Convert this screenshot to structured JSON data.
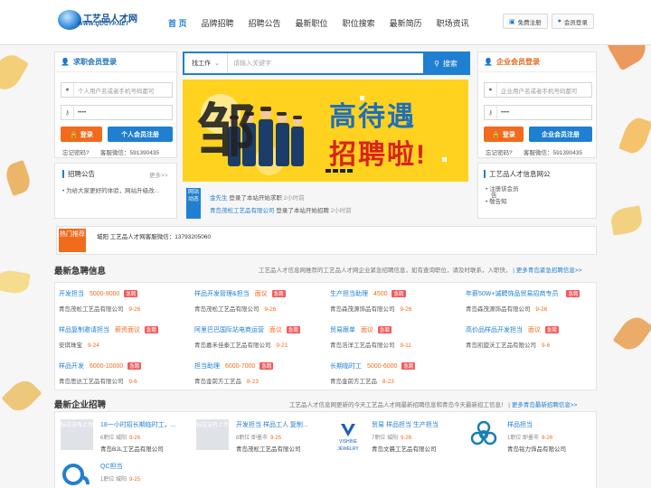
{
  "header": {
    "logo_title": "工艺品人才网",
    "logo_url": "WWW.QDGYP.NET",
    "nav": [
      "首 页",
      "品牌招聘",
      "招聘公告",
      "最新职位",
      "职位搜索",
      "最新简历",
      "职场资讯"
    ],
    "register": "免费注册",
    "login": "会员登录"
  },
  "seeker_login": {
    "title": "求职会员登录",
    "account_placeholder": "个人用户名或者手机号码都可",
    "password_mask": "••••",
    "login_btn": "登录",
    "register_btn": "个人会员注册",
    "forgot": "忘记密码?",
    "service": "客服微信：591390435"
  },
  "notice": {
    "title": "招聘公告",
    "more": "更多>>",
    "items": [
      "为给大家更好的体验，网站升级改..."
    ]
  },
  "search": {
    "select": "找工作",
    "placeholder": "请输入关键字",
    "button": "搜索"
  },
  "banner": {
    "big_char": "邹",
    "line1": "高待遇",
    "line2": "招聘啦!"
  },
  "news": {
    "tag": "网站动态",
    "items": [
      {
        "who": "金先生",
        "what": "登录了本站开始求职",
        "time": "2小时前"
      },
      {
        "who": "青岛茂松工艺品有限公司",
        "what": "登录了本站开始招聘",
        "time": "2小时前"
      }
    ]
  },
  "company_login": {
    "title": "企业会员登录",
    "account_placeholder": "企业用户名或者手机号码都可",
    "password_mask": "••••",
    "login_btn": "登录",
    "register_btn": "企业会员注册",
    "forgot": "忘记密码?",
    "service": "客服微信：591390435"
  },
  "info": {
    "title": "工艺品人才信息网公",
    "items": [
      "注册该会员",
      "告",
      "敬告知"
    ]
  },
  "hot": {
    "tag": "热门推荐",
    "text": "城阳 工艺品人才网客服微信：13793205060"
  },
  "urgent": {
    "title": "最新急聘信息",
    "desc": "工艺品人才信息网推荐的工艺品人才网企业紧急招聘信息，如有查询职位，请及时联系，入职快，",
    "more": "更多青岛紧急招聘信息>>",
    "urg_label": "急聘",
    "jobs": [
      {
        "title": "开发担当",
        "salary": "5000-9000",
        "company": "青岛茂松工艺品有限公司",
        "date": "9-26"
      },
      {
        "title": "样品开发管理&担当",
        "salary": "面议",
        "company": "青岛茂松工艺品有限公司",
        "date": "9-26"
      },
      {
        "title": "生产担当助理",
        "salary": "4500",
        "company": "青岛森茂源饰品有限公司",
        "date": "9-26"
      },
      {
        "title": "年薪50W+诚聘饰品贸易招商专员",
        "salary": "",
        "company": "青岛森茂源饰品有限公司",
        "date": "9-26"
      },
      {
        "title": "样品复制邀请担当",
        "salary": "薪资面议",
        "company": "安琪珠宝",
        "date": "9-24"
      },
      {
        "title": "阿里巴巴国际站电商运营",
        "salary": "面议",
        "company": "青岛嘉禾佳泰工艺品有限公司",
        "date": "9-21"
      },
      {
        "title": "贸易跟单",
        "salary": "面议",
        "company": "青岛浩洋工艺品有限公司",
        "date": "9-11"
      },
      {
        "title": "高价品样品开发担当",
        "salary": "面议",
        "company": "青岛凯旋沃工艺品有限公司",
        "date": "9-6"
      },
      {
        "title": "样品开发",
        "salary": "6000-10000",
        "company": "青岛思达工艺品有限公司",
        "date": "9-6"
      },
      {
        "title": "担当助理",
        "salary": "6000-7000",
        "company": "青岛金前方工艺品",
        "date": "8-23"
      },
      {
        "title": "长期临时工",
        "salary": "5000-6000",
        "company": "青岛金前方工艺品",
        "date": "8-23"
      }
    ]
  },
  "companies": {
    "title": "最新企业招聘",
    "desc": "工艺品人才信息网更新的今天工艺品人才网最新招聘信息和青岛今天最新招工信息！",
    "more": "更多青岛最新招聘信息>>",
    "placeholder_logo": "标志没有上传",
    "items": [
      {
        "jobs": "18一小时招长期临时工，...",
        "meta": "6职位 城阳",
        "date": "9-26",
        "name": "青岛BJL工艺品有限公司",
        "logo": "none"
      },
      {
        "jobs": "开发担当 样品工人 复制...",
        "meta": "8职位 即墨市",
        "date": "9-25",
        "name": "青岛茂松工艺品有限公司",
        "logo": "none"
      },
      {
        "jobs": "贸易 样品担当 生产担当",
        "meta": "7职位 城阳",
        "date": "9-26",
        "name": "青岛文晨工艺品有限公司",
        "logo": "vishine",
        "logo_text": "VISHINE JEWELRY"
      },
      {
        "jobs": "样品担当",
        "meta": "1职位 即墨市",
        "date": "9-26",
        "name": "青岛铭力饰品有限公司",
        "logo": "biohazard"
      },
      {
        "jobs": "QC担当",
        "meta": "1职位 城阳",
        "date": "9-25",
        "name": "",
        "logo": "qc"
      }
    ]
  }
}
